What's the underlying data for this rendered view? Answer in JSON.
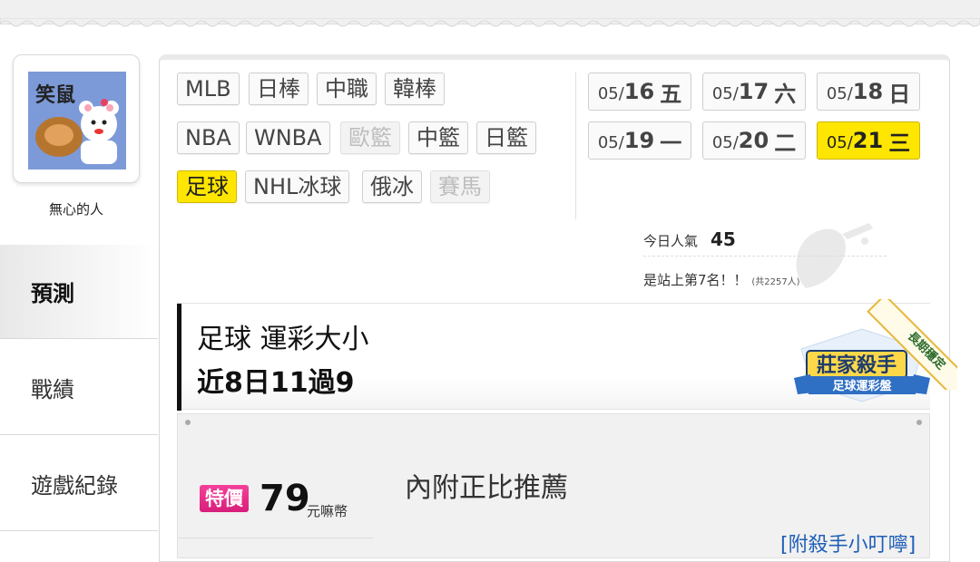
{
  "user": {
    "avatar_caption": "笑鼠",
    "name": "無心的人"
  },
  "sidebar": {
    "items": [
      {
        "label": "預測",
        "active": true
      },
      {
        "label": "戰績",
        "active": false
      },
      {
        "label": "遊戲紀錄",
        "active": false
      }
    ]
  },
  "sports": {
    "row1": [
      {
        "label": "MLB",
        "state": "normal"
      },
      {
        "label": "日棒",
        "state": "normal"
      },
      {
        "label": "中職",
        "state": "normal"
      },
      {
        "label": "韓棒",
        "state": "normal"
      }
    ],
    "row2": [
      {
        "label": "NBA",
        "state": "normal"
      },
      {
        "label": "WNBA",
        "state": "normal"
      },
      {
        "label": "歐籃",
        "state": "disabled"
      },
      {
        "label": "中籃",
        "state": "normal"
      },
      {
        "label": "日籃",
        "state": "normal"
      }
    ],
    "row3": [
      {
        "label": "足球",
        "state": "active"
      },
      {
        "label": "NHL冰球",
        "state": "normal"
      },
      {
        "label": "俄冰",
        "state": "normal"
      },
      {
        "label": "賽馬",
        "state": "disabled"
      }
    ]
  },
  "dates": [
    {
      "md_prefix": "05/",
      "day": "16",
      "weekday": "五",
      "active": false
    },
    {
      "md_prefix": "05/",
      "day": "17",
      "weekday": "六",
      "active": false
    },
    {
      "md_prefix": "05/",
      "day": "18",
      "weekday": "日",
      "active": false
    },
    {
      "md_prefix": "05/",
      "day": "19",
      "weekday": "一",
      "active": false
    },
    {
      "md_prefix": "05/",
      "day": "20",
      "weekday": "二",
      "active": false
    },
    {
      "md_prefix": "05/",
      "day": "21",
      "weekday": "三",
      "active": true
    }
  ],
  "popularity": {
    "label": "今日人氣",
    "value": "45",
    "rank_text": "是站上第7名！！",
    "total_text": "(共2257人)"
  },
  "section": {
    "title": "足球 運彩大小",
    "record": "近8日11過9",
    "badge_title": "莊家殺手",
    "badge_subtitle": "足球運彩盤",
    "ribbon_text": "長期穩定"
  },
  "offer": {
    "price_label": "特價",
    "price": "79",
    "unit": "元嘛幣",
    "description": "內附正比推薦",
    "tip_link": "[附殺手小叮嚀]"
  },
  "colors": {
    "active_yellow": "#ffe600",
    "price_pink": "#e72c8a",
    "link_blue": "#1f5fb7"
  }
}
